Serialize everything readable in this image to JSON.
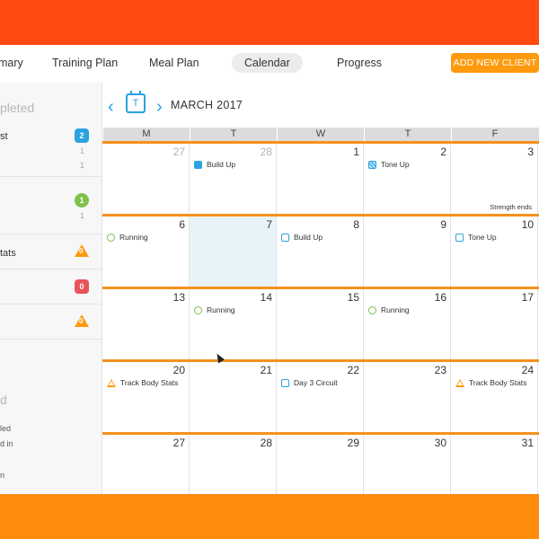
{
  "nav": {
    "items": [
      {
        "label": "mary",
        "name": "tab-summary"
      },
      {
        "label": "Training Plan",
        "name": "tab-training-plan"
      },
      {
        "label": "Meal Plan",
        "name": "tab-meal-plan"
      },
      {
        "label": "Calendar",
        "name": "tab-calendar",
        "active": true
      },
      {
        "label": "Progress",
        "name": "tab-progress"
      }
    ],
    "add_client_label": "ADD NEW CLIENT"
  },
  "sidebar": {
    "heading_completed": "pleted",
    "row1_label": "st",
    "row1_badge": "2",
    "row1_sub1": "1",
    "row1_sub2": "1",
    "row2_badge": "1",
    "row2_sub": "1",
    "row3_label": "tats",
    "row3_badge": "0",
    "row4_badge": "0",
    "row5_badge": "0",
    "heading_2": "d",
    "line1": "led",
    "line2": "d in",
    "line3": "n"
  },
  "calendar": {
    "month_label": "MARCH 2017",
    "today_icon_letter": "T",
    "prev_icon": "chevron-left-icon",
    "next_icon": "chevron-right-icon",
    "days_of_week": [
      "M",
      "T",
      "W",
      "T",
      "F"
    ],
    "weeks": [
      {
        "days": [
          {
            "num": "27",
            "prev": true
          },
          {
            "num": "28",
            "prev": true,
            "event": {
              "label": "Build Up",
              "icon": "filled-square-icon"
            }
          },
          {
            "num": "1"
          },
          {
            "num": "2",
            "event": {
              "label": "Tone Up",
              "icon": "hatched-square-icon"
            }
          },
          {
            "num": "3",
            "note": "Strength ends"
          }
        ]
      },
      {
        "days": [
          {
            "num": "6",
            "event": {
              "label": "Running",
              "icon": "circle-icon"
            }
          },
          {
            "num": "7",
            "today": true
          },
          {
            "num": "8",
            "event": {
              "label": "Build Up",
              "icon": "square-icon"
            }
          },
          {
            "num": "9"
          },
          {
            "num": "10",
            "event": {
              "label": "Tone Up",
              "icon": "square-icon"
            }
          }
        ]
      },
      {
        "days": [
          {
            "num": "13"
          },
          {
            "num": "14",
            "event": {
              "label": "Running",
              "icon": "circle-icon"
            }
          },
          {
            "num": "15"
          },
          {
            "num": "16",
            "event": {
              "label": "Running",
              "icon": "circle-icon"
            }
          },
          {
            "num": "17"
          }
        ]
      },
      {
        "days": [
          {
            "num": "20",
            "event": {
              "label": "Track Body Stats",
              "icon": "triangle-icon"
            }
          },
          {
            "num": "21"
          },
          {
            "num": "22",
            "event": {
              "label": "Day 3 Circuit",
              "icon": "square-icon"
            }
          },
          {
            "num": "23"
          },
          {
            "num": "24",
            "event": {
              "label": "Track Body Stats",
              "icon": "triangle-icon"
            }
          }
        ]
      },
      {
        "days": [
          {
            "num": "27"
          },
          {
            "num": "28"
          },
          {
            "num": "29"
          },
          {
            "num": "30"
          },
          {
            "num": "31"
          }
        ]
      }
    ]
  },
  "colors": {
    "brand_orange": "#ff9a0e",
    "accent_blue": "#2aa3e0",
    "success_green": "#7ec24a",
    "danger_red": "#e8535b",
    "week_line": "#f5911e"
  }
}
